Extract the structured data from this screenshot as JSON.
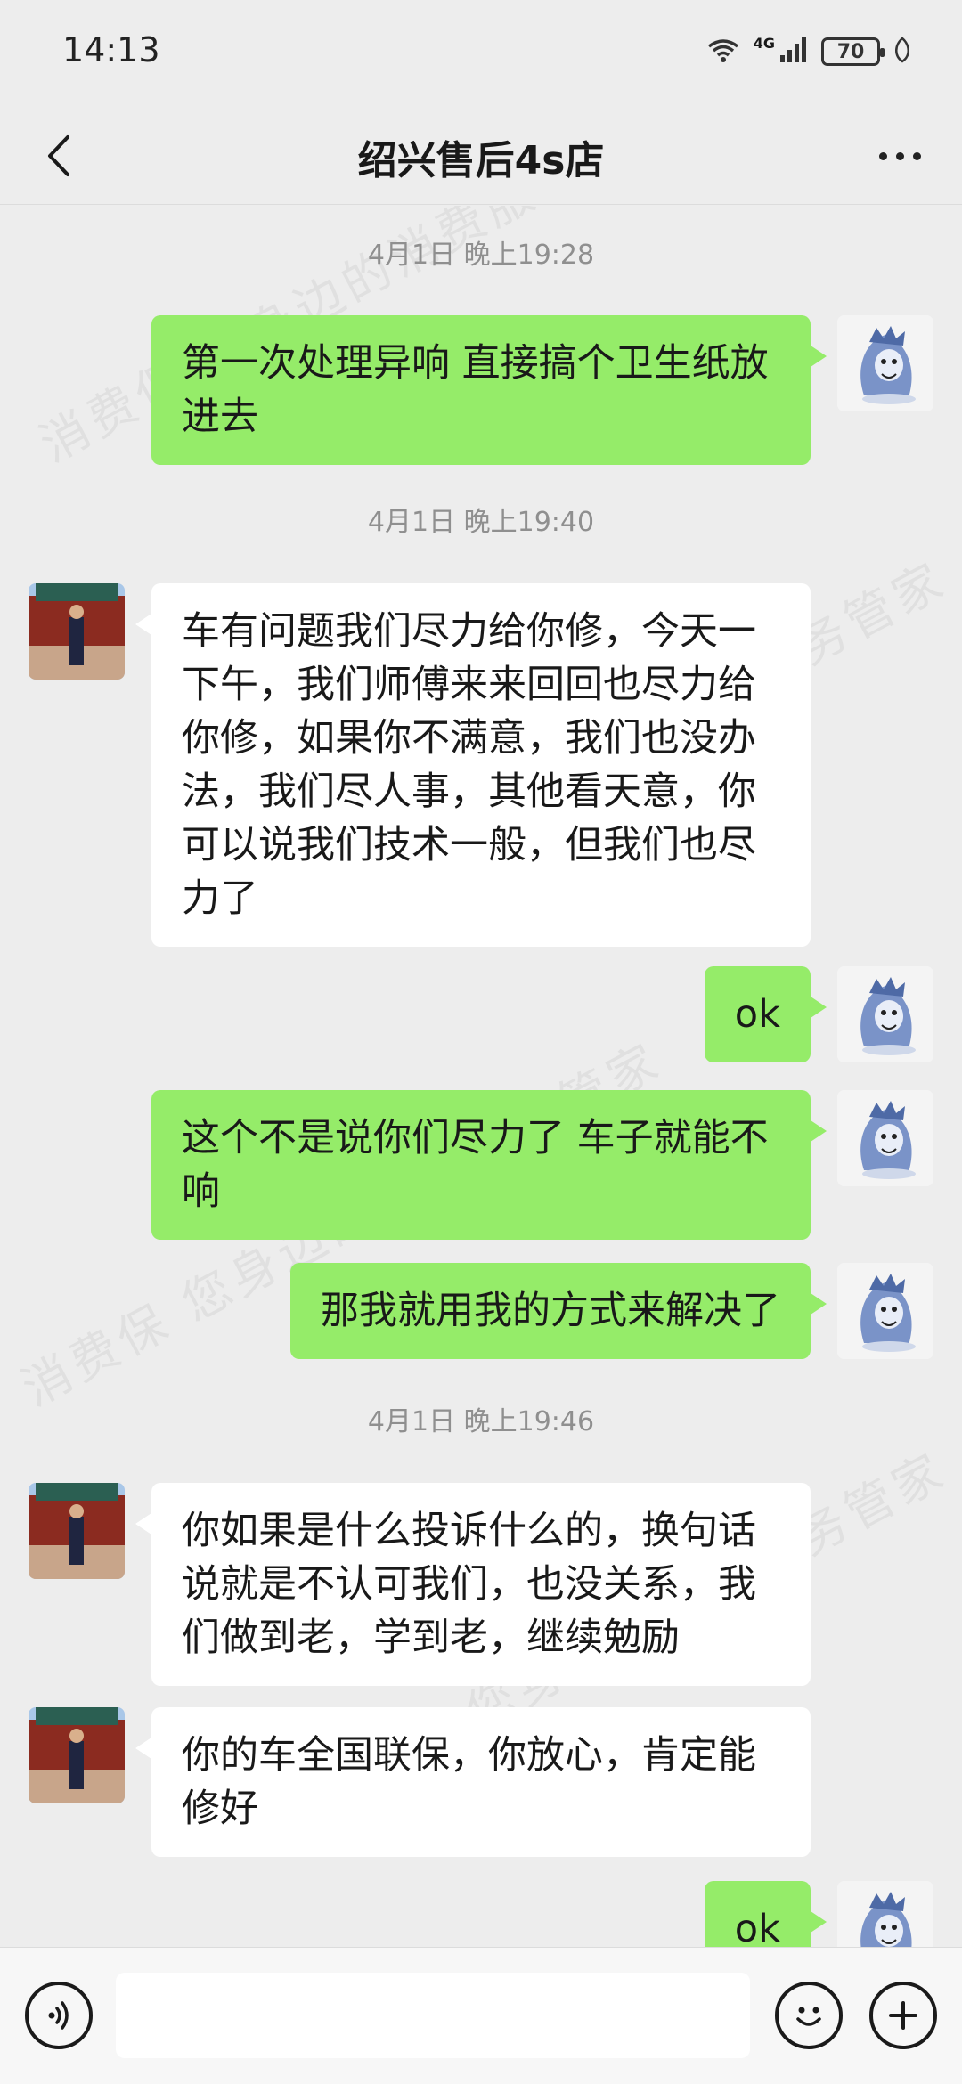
{
  "status_bar": {
    "time": "14:13",
    "battery": "70",
    "network": "4G",
    "wifi_label": "6"
  },
  "nav": {
    "title": "绍兴售后4s店"
  },
  "watermark": "消费保 您身边的消费服务管家",
  "messages": [
    {
      "type": "time",
      "text": "4月1日 晚上19:28"
    },
    {
      "type": "sent",
      "text": "第一次处理异响 直接搞个卫生纸放进去"
    },
    {
      "type": "time",
      "text": "4月1日 晚上19:40"
    },
    {
      "type": "recv",
      "text": "车有问题我们尽力给你修，今天一下午，我们师傅来来回回也尽力给你修，如果你不满意，我们也没办法，我们尽人事，其他看天意，你可以说我们技术一般，但我们也尽力了"
    },
    {
      "type": "sent",
      "text": "ok"
    },
    {
      "type": "sent",
      "text": "这个不是说你们尽力了  车子就能不响"
    },
    {
      "type": "sent",
      "text": "那我就用我的方式来解决了"
    },
    {
      "type": "time",
      "text": "4月1日 晚上19:46"
    },
    {
      "type": "recv",
      "text": "你如果是什么投诉什么的，换句话说就是不认可我们，也没关系，我们做到老，学到老，继续勉励"
    },
    {
      "type": "recv",
      "text": "你的车全国联保，你放心，肯定能修好"
    },
    {
      "type": "sent",
      "text": "ok"
    }
  ],
  "colors": {
    "sent_bubble": "#95ec69",
    "recv_bubble": "#ffffff",
    "background": "#ededed"
  },
  "icons": {
    "back": "chevron-left-icon",
    "more": "more-dots-icon",
    "voice": "voice-icon",
    "emoji": "emoji-icon",
    "plus": "plus-icon"
  }
}
